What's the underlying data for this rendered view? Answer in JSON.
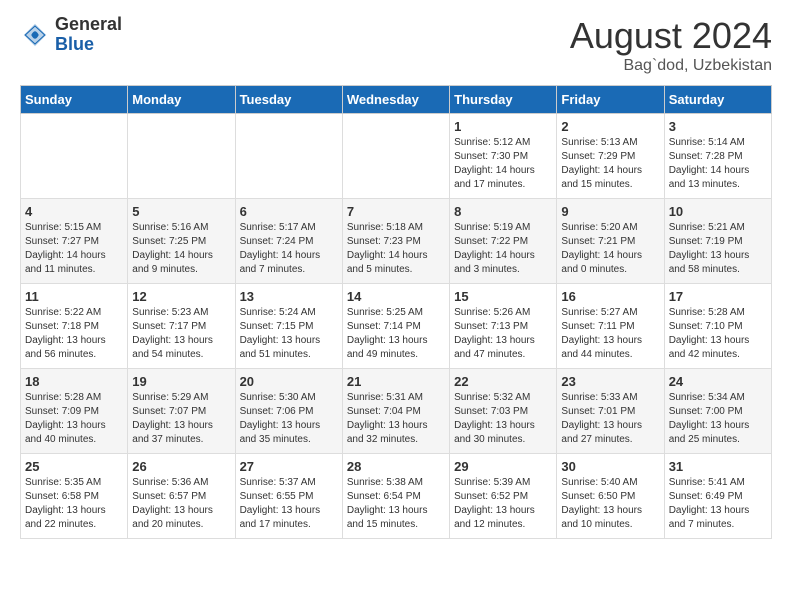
{
  "header": {
    "logo_general": "General",
    "logo_blue": "Blue",
    "title": "August 2024",
    "subtitle": "Bag`dod, Uzbekistan"
  },
  "days_of_week": [
    "Sunday",
    "Monday",
    "Tuesday",
    "Wednesday",
    "Thursday",
    "Friday",
    "Saturday"
  ],
  "weeks": [
    [
      {
        "day": "",
        "info": ""
      },
      {
        "day": "",
        "info": ""
      },
      {
        "day": "",
        "info": ""
      },
      {
        "day": "",
        "info": ""
      },
      {
        "day": "1",
        "info": "Sunrise: 5:12 AM\nSunset: 7:30 PM\nDaylight: 14 hours and 17 minutes."
      },
      {
        "day": "2",
        "info": "Sunrise: 5:13 AM\nSunset: 7:29 PM\nDaylight: 14 hours and 15 minutes."
      },
      {
        "day": "3",
        "info": "Sunrise: 5:14 AM\nSunset: 7:28 PM\nDaylight: 14 hours and 13 minutes."
      }
    ],
    [
      {
        "day": "4",
        "info": "Sunrise: 5:15 AM\nSunset: 7:27 PM\nDaylight: 14 hours and 11 minutes."
      },
      {
        "day": "5",
        "info": "Sunrise: 5:16 AM\nSunset: 7:25 PM\nDaylight: 14 hours and 9 minutes."
      },
      {
        "day": "6",
        "info": "Sunrise: 5:17 AM\nSunset: 7:24 PM\nDaylight: 14 hours and 7 minutes."
      },
      {
        "day": "7",
        "info": "Sunrise: 5:18 AM\nSunset: 7:23 PM\nDaylight: 14 hours and 5 minutes."
      },
      {
        "day": "8",
        "info": "Sunrise: 5:19 AM\nSunset: 7:22 PM\nDaylight: 14 hours and 3 minutes."
      },
      {
        "day": "9",
        "info": "Sunrise: 5:20 AM\nSunset: 7:21 PM\nDaylight: 14 hours and 0 minutes."
      },
      {
        "day": "10",
        "info": "Sunrise: 5:21 AM\nSunset: 7:19 PM\nDaylight: 13 hours and 58 minutes."
      }
    ],
    [
      {
        "day": "11",
        "info": "Sunrise: 5:22 AM\nSunset: 7:18 PM\nDaylight: 13 hours and 56 minutes."
      },
      {
        "day": "12",
        "info": "Sunrise: 5:23 AM\nSunset: 7:17 PM\nDaylight: 13 hours and 54 minutes."
      },
      {
        "day": "13",
        "info": "Sunrise: 5:24 AM\nSunset: 7:15 PM\nDaylight: 13 hours and 51 minutes."
      },
      {
        "day": "14",
        "info": "Sunrise: 5:25 AM\nSunset: 7:14 PM\nDaylight: 13 hours and 49 minutes."
      },
      {
        "day": "15",
        "info": "Sunrise: 5:26 AM\nSunset: 7:13 PM\nDaylight: 13 hours and 47 minutes."
      },
      {
        "day": "16",
        "info": "Sunrise: 5:27 AM\nSunset: 7:11 PM\nDaylight: 13 hours and 44 minutes."
      },
      {
        "day": "17",
        "info": "Sunrise: 5:28 AM\nSunset: 7:10 PM\nDaylight: 13 hours and 42 minutes."
      }
    ],
    [
      {
        "day": "18",
        "info": "Sunrise: 5:28 AM\nSunset: 7:09 PM\nDaylight: 13 hours and 40 minutes."
      },
      {
        "day": "19",
        "info": "Sunrise: 5:29 AM\nSunset: 7:07 PM\nDaylight: 13 hours and 37 minutes."
      },
      {
        "day": "20",
        "info": "Sunrise: 5:30 AM\nSunset: 7:06 PM\nDaylight: 13 hours and 35 minutes."
      },
      {
        "day": "21",
        "info": "Sunrise: 5:31 AM\nSunset: 7:04 PM\nDaylight: 13 hours and 32 minutes."
      },
      {
        "day": "22",
        "info": "Sunrise: 5:32 AM\nSunset: 7:03 PM\nDaylight: 13 hours and 30 minutes."
      },
      {
        "day": "23",
        "info": "Sunrise: 5:33 AM\nSunset: 7:01 PM\nDaylight: 13 hours and 27 minutes."
      },
      {
        "day": "24",
        "info": "Sunrise: 5:34 AM\nSunset: 7:00 PM\nDaylight: 13 hours and 25 minutes."
      }
    ],
    [
      {
        "day": "25",
        "info": "Sunrise: 5:35 AM\nSunset: 6:58 PM\nDaylight: 13 hours and 22 minutes."
      },
      {
        "day": "26",
        "info": "Sunrise: 5:36 AM\nSunset: 6:57 PM\nDaylight: 13 hours and 20 minutes."
      },
      {
        "day": "27",
        "info": "Sunrise: 5:37 AM\nSunset: 6:55 PM\nDaylight: 13 hours and 17 minutes."
      },
      {
        "day": "28",
        "info": "Sunrise: 5:38 AM\nSunset: 6:54 PM\nDaylight: 13 hours and 15 minutes."
      },
      {
        "day": "29",
        "info": "Sunrise: 5:39 AM\nSunset: 6:52 PM\nDaylight: 13 hours and 12 minutes."
      },
      {
        "day": "30",
        "info": "Sunrise: 5:40 AM\nSunset: 6:50 PM\nDaylight: 13 hours and 10 minutes."
      },
      {
        "day": "31",
        "info": "Sunrise: 5:41 AM\nSunset: 6:49 PM\nDaylight: 13 hours and 7 minutes."
      }
    ]
  ]
}
